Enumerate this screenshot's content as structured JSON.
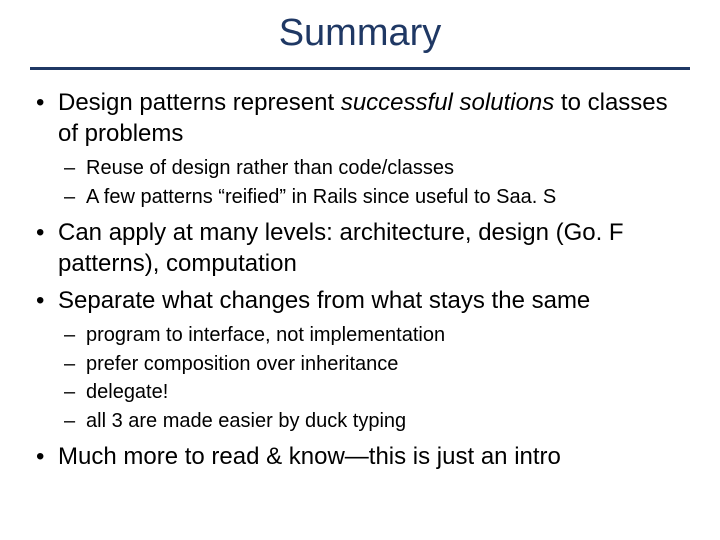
{
  "title": "Summary",
  "bullets": {
    "b1_pre": "Design patterns represent ",
    "b1_em": "successful solutions",
    "b1_post": " to classes of problems",
    "b1_sub1": "Reuse of design rather than code/classes",
    "b1_sub2": "A few patterns “reified” in Rails since useful to Saa. S",
    "b2": "Can apply at many levels: architecture, design (Go. F patterns), computation",
    "b3": "Separate what changes from what stays the same",
    "b3_sub1": "program to interface, not implementation",
    "b3_sub2": "prefer composition over inheritance",
    "b3_sub3": "delegate!",
    "b3_sub4": "all 3 are made easier by duck typing",
    "b4": "Much more to read & know—this is just an intro"
  }
}
